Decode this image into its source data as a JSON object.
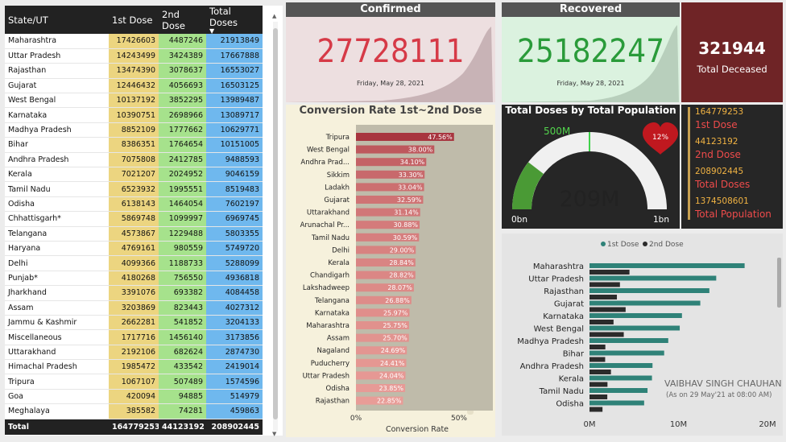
{
  "table": {
    "headers": {
      "state": "State/UT",
      "dose1": "1st Dose",
      "dose2": "2nd Dose",
      "total": "Total Doses",
      "sort_icon": "triangle-down-icon"
    },
    "rows": [
      {
        "state": "Maharashtra",
        "dose1": "17426603",
        "dose2": "4487246",
        "total": "21913849"
      },
      {
        "state": "Uttar Pradesh",
        "dose1": "14243499",
        "dose2": "3424389",
        "total": "17667888"
      },
      {
        "state": "Rajasthan",
        "dose1": "13474390",
        "dose2": "3078637",
        "total": "16553027"
      },
      {
        "state": "Gujarat",
        "dose1": "12446432",
        "dose2": "4056693",
        "total": "16503125"
      },
      {
        "state": "West Bengal",
        "dose1": "10137192",
        "dose2": "3852295",
        "total": "13989487"
      },
      {
        "state": "Karnataka",
        "dose1": "10390751",
        "dose2": "2698966",
        "total": "13089717"
      },
      {
        "state": "Madhya Pradesh",
        "dose1": "8852109",
        "dose2": "1777662",
        "total": "10629771"
      },
      {
        "state": "Bihar",
        "dose1": "8386351",
        "dose2": "1764654",
        "total": "10151005"
      },
      {
        "state": "Andhra Pradesh",
        "dose1": "7075808",
        "dose2": "2412785",
        "total": "9488593"
      },
      {
        "state": "Kerala",
        "dose1": "7021207",
        "dose2": "2024952",
        "total": "9046159"
      },
      {
        "state": "Tamil Nadu",
        "dose1": "6523932",
        "dose2": "1995551",
        "total": "8519483"
      },
      {
        "state": "Odisha",
        "dose1": "6138143",
        "dose2": "1464054",
        "total": "7602197"
      },
      {
        "state": "Chhattisgarh*",
        "dose1": "5869748",
        "dose2": "1099997",
        "total": "6969745"
      },
      {
        "state": "Telangana",
        "dose1": "4573867",
        "dose2": "1229488",
        "total": "5803355"
      },
      {
        "state": "Haryana",
        "dose1": "4769161",
        "dose2": "980559",
        "total": "5749720"
      },
      {
        "state": "Delhi",
        "dose1": "4099366",
        "dose2": "1188733",
        "total": "5288099"
      },
      {
        "state": "Punjab*",
        "dose1": "4180268",
        "dose2": "756550",
        "total": "4936818"
      },
      {
        "state": "Jharkhand",
        "dose1": "3391076",
        "dose2": "693382",
        "total": "4084458"
      },
      {
        "state": "Assam",
        "dose1": "3203869",
        "dose2": "823443",
        "total": "4027312"
      },
      {
        "state": "Jammu & Kashmir",
        "dose1": "2662281",
        "dose2": "541852",
        "total": "3204133"
      },
      {
        "state": "Miscellaneous",
        "dose1": "1717716",
        "dose2": "1456140",
        "total": "3173856"
      },
      {
        "state": "Uttarakhand",
        "dose1": "2192106",
        "dose2": "682624",
        "total": "2874730"
      },
      {
        "state": "Himachal Pradesh",
        "dose1": "1985472",
        "dose2": "433542",
        "total": "2419014"
      },
      {
        "state": "Tripura",
        "dose1": "1067107",
        "dose2": "507489",
        "total": "1574596"
      },
      {
        "state": "Goa",
        "dose1": "420094",
        "dose2": "94885",
        "total": "514979"
      },
      {
        "state": "Meghalaya",
        "dose1": "385582",
        "dose2": "74281",
        "total": "459863"
      }
    ],
    "total": {
      "state": "Total",
      "dose1": "164779253",
      "dose2": "44123192",
      "total": "208902445"
    },
    "colors": {
      "dose1": "#ecd580",
      "dose2": "#a6e28c",
      "total": "#6fb8ee"
    }
  },
  "confirmed": {
    "title": "Confirmed",
    "value": "27728111",
    "date": "Friday, May 28, 2021",
    "color": "#d63a47"
  },
  "recovered": {
    "title": "Recovered",
    "value": "25182247",
    "date": "Friday, May 28, 2021",
    "color": "#2a9b3a"
  },
  "deceased": {
    "value": "321944",
    "label": "Total Deceased"
  },
  "gauge": {
    "title": "Total Doses by Total Population",
    "value_label": "209M",
    "value": 209,
    "target": 500,
    "target_label": "500M",
    "max": 1000,
    "min_label": "0bn",
    "max_label": "1bn",
    "badge": "12%",
    "badge_icon": "heart-icon"
  },
  "stats": [
    {
      "value": "164779253",
      "label": "1st Dose"
    },
    {
      "value": "44123192",
      "label": "2nd Dose"
    },
    {
      "value": "208902445",
      "label": "Total Doses"
    },
    {
      "value": "1374508601",
      "label": "Total Population"
    }
  ],
  "dose_chart_note": {
    "author": "VAIBHAV SINGH CHAUHAN",
    "date_note": "(As on 29 May'21 at 08:00 AM)"
  },
  "chart_data": [
    {
      "type": "bar",
      "title": "Conversion Rate 1st~2nd Dose",
      "xlabel": "Conversion Rate",
      "ylabel": "",
      "xlim": [
        0,
        50
      ],
      "x_ticks": [
        "0%",
        "50%"
      ],
      "categories": [
        "Tripura",
        "West Bengal",
        "Andhra Prad...",
        "Sikkim",
        "Ladakh",
        "Gujarat",
        "Uttarakhand",
        "Arunachal Pr...",
        "Tamil Nadu",
        "Delhi",
        "Kerala",
        "Chandigarh",
        "Lakshadweep",
        "Telangana",
        "Karnataka",
        "Maharashtra",
        "Assam",
        "Nagaland",
        "Puducherry",
        "Uttar Pradesh",
        "Odisha",
        "Rajasthan"
      ],
      "values": [
        47.56,
        38.0,
        34.1,
        33.3,
        33.04,
        32.59,
        31.14,
        30.88,
        30.59,
        29.0,
        28.84,
        28.82,
        28.07,
        26.88,
        25.97,
        25.75,
        25.7,
        24.69,
        24.41,
        24.04,
        23.85,
        22.85
      ],
      "data_labels": [
        "47.56%",
        "38.00%",
        "34.10%",
        "33.30%",
        "33.04%",
        "32.59%",
        "31.14%",
        "30.88%",
        "30.59%",
        "29.00%",
        "28.84%",
        "28.82%",
        "28.07%",
        "26.88%",
        "25.97%",
        "25.75%",
        "25.70%",
        "24.69%",
        "24.41%",
        "24.04%",
        "23.85%",
        "22.85%"
      ],
      "color_high": "#a8353f",
      "color_low": "#e89c97"
    },
    {
      "type": "bar",
      "orientation": "horizontal",
      "title": "",
      "xlabel": "",
      "ylabel": "",
      "xlim": [
        0,
        20
      ],
      "x_ticks": [
        "0M",
        "10M",
        "20M"
      ],
      "legend_placement": "top-center",
      "categories": [
        "Maharashtra",
        "Uttar Pradesh",
        "Rajasthan",
        "Gujarat",
        "Karnataka",
        "West Bengal",
        "Madhya Pradesh",
        "Bihar",
        "Andhra Pradesh",
        "Kerala",
        "Tamil Nadu",
        "Odisha"
      ],
      "series": [
        {
          "name": "1st Dose",
          "color": "#2f8278",
          "values": [
            17.43,
            14.24,
            13.47,
            12.45,
            10.39,
            10.14,
            8.85,
            8.39,
            7.08,
            7.02,
            6.52,
            6.14
          ]
        },
        {
          "name": "2nd Dose",
          "color": "#2b2b2b",
          "values": [
            4.49,
            3.42,
            3.08,
            4.06,
            2.7,
            3.85,
            1.78,
            1.76,
            2.41,
            2.02,
            2.0,
            1.46
          ]
        }
      ]
    }
  ]
}
